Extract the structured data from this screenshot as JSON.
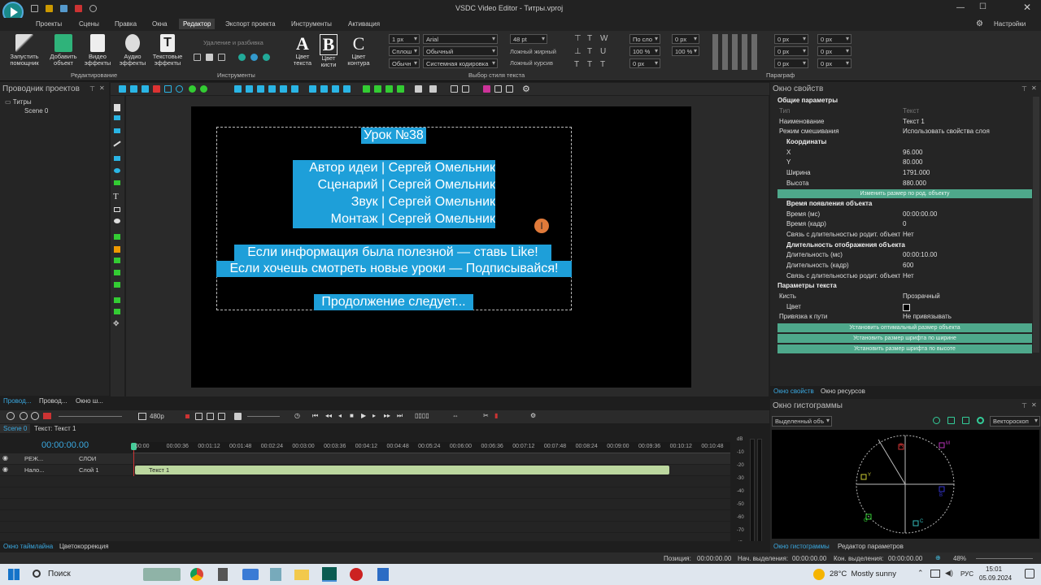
{
  "window": {
    "title": "VSDC Video Editor - Титры.vproj",
    "settings_label": "Настройки"
  },
  "menu": [
    "Проекты",
    "Сцены",
    "Правка",
    "Окна",
    "Редактор",
    "Экспорт проекта",
    "Инструменты",
    "Активация"
  ],
  "ribbon": {
    "buttons": [
      {
        "label": "Запустить\nпомощник"
      },
      {
        "label": "Добавить\nобъект"
      },
      {
        "label": "Видео\nэффекты"
      },
      {
        "label": "Аудио\nэффекты"
      },
      {
        "label": "Текстовые\nэффекты"
      }
    ],
    "groups": {
      "editing": "Редактирование",
      "tools": "Инструменты",
      "text_style": "Выбор стиля текста",
      "paragraph": "Параграф"
    },
    "remove_split": "Удаление и разбивка",
    "color_buttons": [
      "Цвет\nтекста",
      "Цвет\nкисти",
      "Цвет\nконтура"
    ],
    "combos": {
      "stroke_width": "1 px",
      "font": "Arial",
      "font_size": "48 pt",
      "line": "Сплош",
      "style": "Обычный",
      "normal": "Обычн",
      "encoding": "Системная кодировка",
      "alignment": "По сло",
      "scale1": "100 %",
      "scale2": "100 %",
      "px0a": "0 px",
      "px0b": "0 px",
      "px0c": "0 px",
      "px0d": "0 px",
      "px0e": "0 px",
      "px0f": "0 px",
      "px0g": "0 px",
      "px0h": "0 px",
      "px0i": "0 px"
    },
    "fake_bold": "Ложный жирный",
    "fake_italic": "Ложный курсив"
  },
  "project_explorer": {
    "title": "Проводник проектов",
    "root": "Титры",
    "scene": "Scene 0",
    "tabs": [
      "Провод...",
      "Провод...",
      "Окно ш..."
    ]
  },
  "canvas_text": {
    "line1": "Урок №38",
    "block2": [
      "Автор идеи | Сергей Омельник",
      "Сценарий | Сергей Омельник",
      "Звук | Сергей Омельник",
      "Монтаж | Сергей Омельник"
    ],
    "line3": "Если информация была полезной — ставь Like!",
    "line4": "Если хочешь смотреть новые уроки — Подписывайся!",
    "line5": "Продолжение следует..."
  },
  "properties": {
    "title": "Окно свойств",
    "sections": {
      "general": "Общие параметры",
      "coords": "Координаты",
      "appear": "Время появления объекта",
      "duration": "Длительность отображения объекта",
      "text_params": "Параметры текста"
    },
    "rows": [
      {
        "k": "Тип",
        "v": "Текст"
      },
      {
        "k": "Наименование",
        "v": "Текст 1"
      },
      {
        "k": "Режим смешивания",
        "v": "Использовать свойства слоя"
      },
      {
        "k": "X",
        "v": "96.000"
      },
      {
        "k": "Y",
        "v": "80.000"
      },
      {
        "k": "Ширина",
        "v": "1791.000"
      },
      {
        "k": "Высота",
        "v": "880.000"
      },
      {
        "k": "Время (мс)",
        "v": "00:00:00.00"
      },
      {
        "k": "Время (кадр)",
        "v": "0"
      },
      {
        "k": "Связь с длительностью родит. объекта",
        "v": "Нет"
      },
      {
        "k": "Длительность (мс)",
        "v": "00:00:10.00"
      },
      {
        "k": "Длительность (кадр)",
        "v": "600"
      },
      {
        "k": "Связь с длительностью родит. объекта",
        "v": "Нет"
      },
      {
        "k": "Кисть",
        "v": "Прозрачный"
      },
      {
        "k": "Цвет",
        "v": ""
      },
      {
        "k": "Привязка к пути",
        "v": "Не привязывать"
      }
    ],
    "btn_resize_parent": "Изменить размер по род. объекту",
    "btn_optimal": "Установить оптимальный размер объекта",
    "btn_font_width": "Установить размер шрифта по ширине",
    "btn_font_height": "Установить размер шрифта по высоте",
    "tabs": [
      "Окно свойств",
      "Окно ресурсов"
    ]
  },
  "histogram": {
    "title": "Окно гистограммы",
    "select": "Выделенный объ",
    "mode": "Вектороскоп",
    "tabs": [
      "Окно гистограммы",
      "Редактор параметров"
    ],
    "labels": {
      "R": "R",
      "M": "M",
      "B": "B",
      "C": "C",
      "G": "G",
      "Y": "Y"
    }
  },
  "preview_toolbar": {
    "resolution": "480p"
  },
  "timeline": {
    "tabs": [
      "Scene 0",
      "Текст: Текст 1"
    ],
    "time": "00:00:00.00",
    "ticks": [
      "00:00",
      "00:00:36",
      "00:01:12",
      "00:01:48",
      "00:02:24",
      "00:03:00",
      "00:03:36",
      "00:04:12",
      "00:04:48",
      "00:05:24",
      "00:06:00",
      "00:06:36",
      "00:07:12",
      "00:07:48",
      "00:08:24",
      "00:09:00",
      "00:09:36",
      "00:10:12",
      "00:10:48"
    ],
    "header_mode": "РЕЖ...",
    "header_layers": "СЛОИ",
    "layer_mode": "Нало...",
    "layer_name": "Слой 1",
    "clip_name": "Текст 1",
    "db_labels": [
      "dB",
      "-10",
      "-20",
      "-30",
      "-40",
      "-50",
      "-60",
      "-70",
      "dB"
    ],
    "bottom_tabs": [
      "Окно таймлайна",
      "Цветокоррекция"
    ]
  },
  "status": {
    "position_label": "Позиция:",
    "position": "00:00:00.00",
    "sel_start_label": "Нач. выделения:",
    "sel_start": "00:00:00.00",
    "sel_end_label": "Кон. выделения:",
    "sel_end": "00:00:00.00",
    "zoom": "48%"
  },
  "taskbar": {
    "search": "Поиск",
    "weather": "28°C  Mostly sunny",
    "lang": "РУС",
    "time": "15:01",
    "date": "05.09.2024"
  }
}
